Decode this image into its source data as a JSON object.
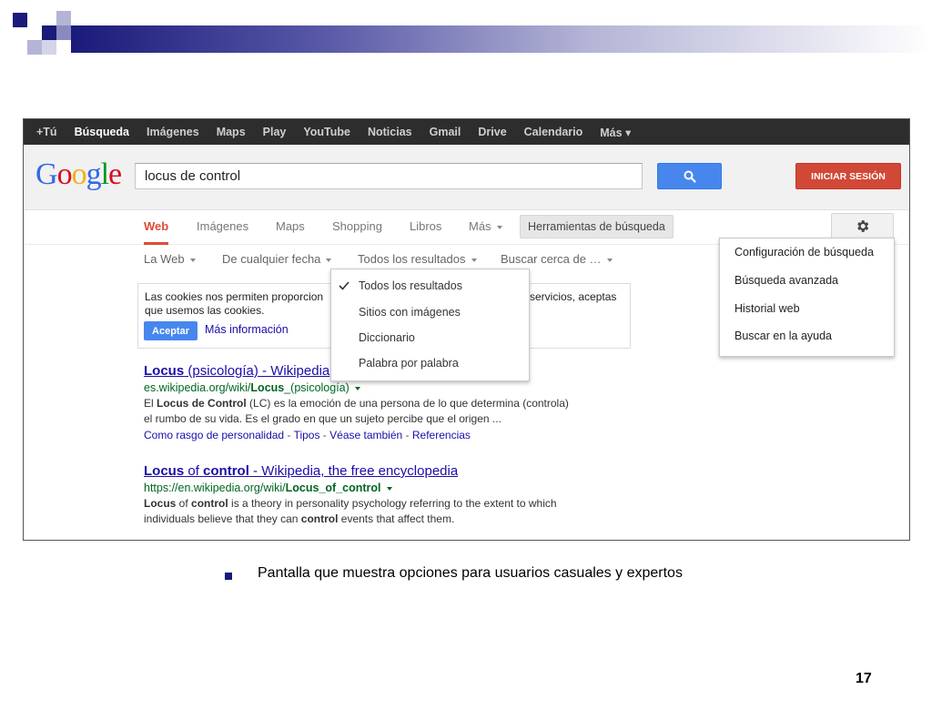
{
  "slide": {
    "caption": "Pantalla que muestra opciones para usuarios casuales y expertos",
    "page_number": "17",
    "colors": {
      "accent": "#1a1a7a"
    }
  },
  "topbar": {
    "items": [
      "+Tú",
      "Búsqueda",
      "Imágenes",
      "Maps",
      "Play",
      "YouTube",
      "Noticias",
      "Gmail",
      "Drive",
      "Calendario",
      "Más ▾"
    ]
  },
  "header": {
    "logo_letters": [
      "G",
      "o",
      "o",
      "g",
      "l",
      "e"
    ],
    "search_value": "locus de control",
    "signin_label": "INICIAR SESIÓN"
  },
  "tabs": {
    "items": [
      "Web",
      "Imágenes",
      "Maps",
      "Shopping",
      "Libros",
      "Más"
    ],
    "tools_label": "Herramientas de búsqueda"
  },
  "filters": {
    "items": [
      "La Web",
      "De cualquier fecha",
      "Todos los resultados",
      "Buscar cerca de …"
    ]
  },
  "cookies": {
    "line1_left": "Las cookies nos permiten proporcion",
    "line1_right": "servicios, aceptas",
    "line2": "que usemos las cookies.",
    "accept_label": "Aceptar",
    "more_info": "Más información"
  },
  "results_dropdown": {
    "items": [
      "Todos los resultados",
      "Sitios con imágenes",
      "Diccionario",
      "Palabra por palabra"
    ]
  },
  "settings_menu": {
    "items": [
      "Configuración de búsqueda",
      "Búsqueda avanzada",
      "Historial web",
      "Buscar en la ayuda"
    ]
  },
  "results": [
    {
      "title_bold": "Locus",
      "title_rest": " (psicología) - Wikipedia",
      "url_pre": "es.wikipedia.org/wiki/",
      "url_bold": "Locus",
      "url_post": "_(psicología)",
      "snippet1_pre": "El ",
      "snippet1_bold": "Locus de Control",
      "snippet1_post": " (LC) es la emoción de una persona de lo que determina (controla)",
      "snippet2": "el rumbo de su vida. Es el grado en que un sujeto percibe que el origen ...",
      "links": [
        "Como rasgo de personalidad",
        "Tipos",
        "Véase también",
        "Referencias"
      ]
    },
    {
      "title_bold1": "Locus",
      "title_mid": " of ",
      "title_bold2": "control",
      "title_rest": " - Wikipedia, the free encyclopedia",
      "url_pre": "https://en.wikipedia.org/wiki/",
      "url_bold": "Locus_of_control",
      "snippet1_bold1": "Locus",
      "snippet1_mid": " of ",
      "snippet1_bold2": "control",
      "snippet1_post": " is a theory in personality psychology referring to the extent to which",
      "snippet2_pre": "individuals believe that they can ",
      "snippet2_bold": "control",
      "snippet2_post": " events that affect them."
    }
  ]
}
